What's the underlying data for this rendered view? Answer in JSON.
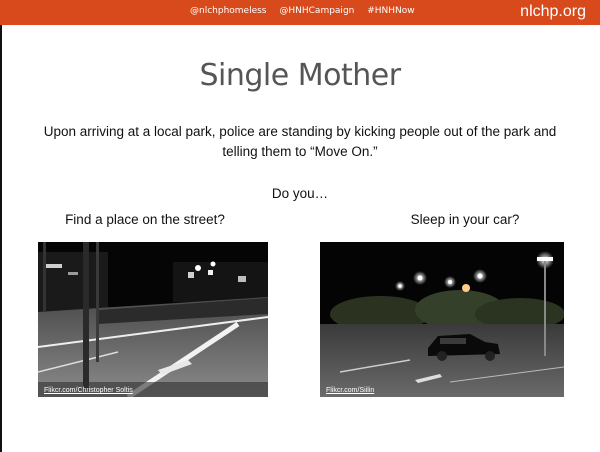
{
  "header": {
    "handles": [
      "@nlchphomeless",
      "@HNHCampaign",
      "#HNHNow"
    ],
    "site": "nlchp.org",
    "bar_color": "#d84a1c"
  },
  "slide": {
    "title": "Single Mother",
    "body": "Upon arriving at a local park, police are standing by kicking people out of the park and telling them to “Move On.”",
    "question": "Do you…",
    "options": [
      {
        "label": "Find a place on the street?",
        "credit": "Flikcr.com/Christopher Soltis"
      },
      {
        "label": "Sleep in your car?",
        "credit": "Flikcr.com/Siilin"
      }
    ]
  }
}
